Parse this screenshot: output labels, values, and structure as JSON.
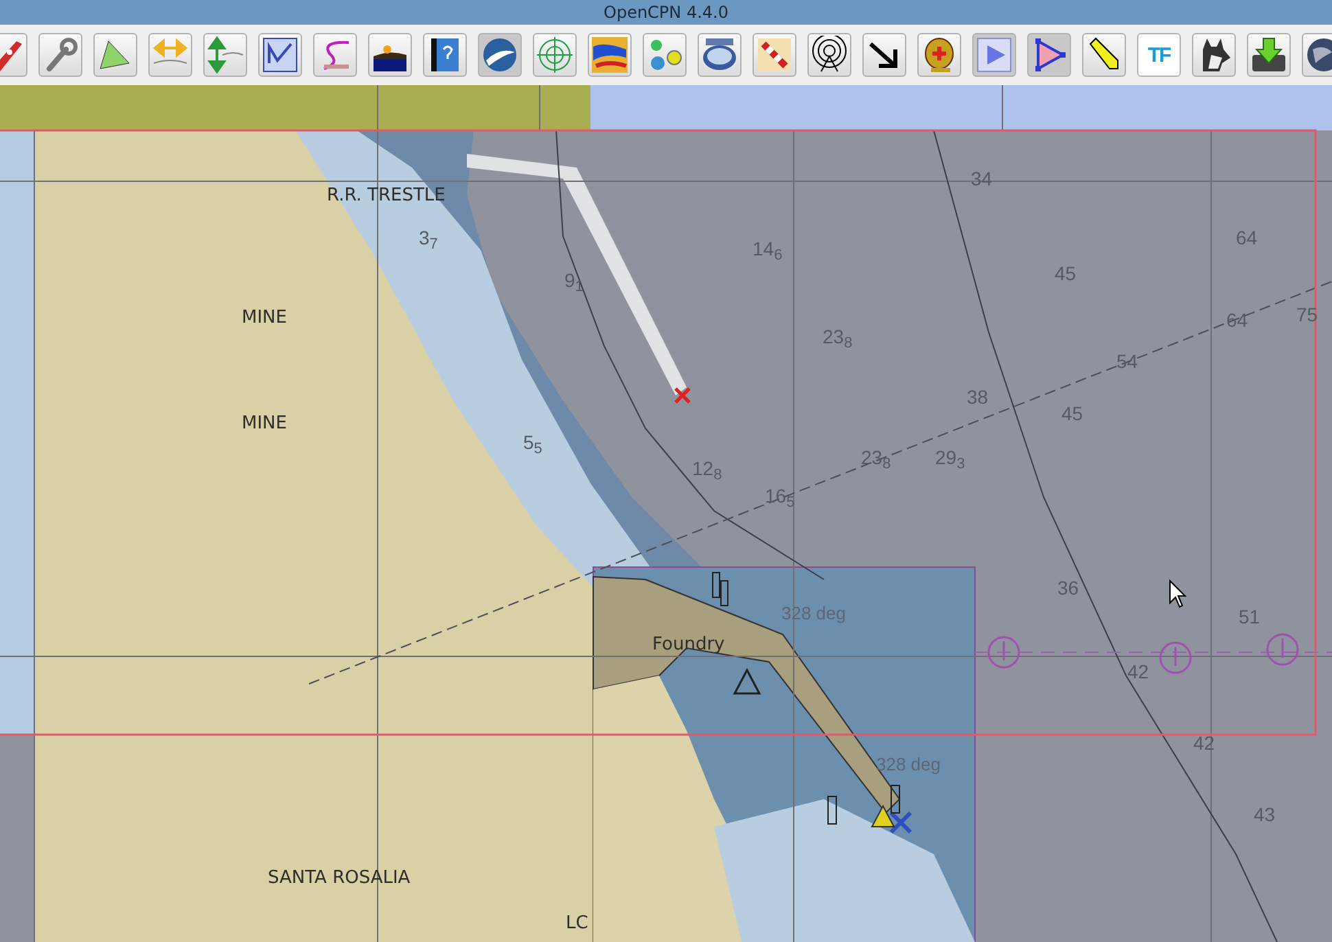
{
  "window": {
    "title": "OpenCPN 4.4.0"
  },
  "toolbar": {
    "text_tool": "TF"
  },
  "chart": {
    "labels": [
      {
        "kind": "place",
        "text": "R.R. TRESTLE"
      },
      {
        "kind": "place",
        "text": "MINE"
      },
      {
        "kind": "place",
        "text": "MINE"
      },
      {
        "kind": "place",
        "text": "Foundry"
      },
      {
        "kind": "place",
        "text": "SANTA ROSALIA"
      },
      {
        "kind": "place",
        "text": "LC"
      },
      {
        "kind": "bearing",
        "text": "328 deg"
      },
      {
        "kind": "bearing",
        "text": "328 deg"
      },
      {
        "kind": "sounding",
        "text": "3$_{7}$"
      },
      {
        "kind": "sounding",
        "text": "9$_{1}$"
      },
      {
        "kind": "sounding",
        "text": "5$_{5}$"
      },
      {
        "kind": "sounding",
        "text": "14$_{6}$"
      },
      {
        "kind": "sounding",
        "text": "23$_{8}$"
      },
      {
        "kind": "sounding",
        "text": "23$_{8}$"
      },
      {
        "kind": "sounding",
        "text": "29$_{3}$"
      },
      {
        "kind": "sounding",
        "text": "12$_{8}$"
      },
      {
        "kind": "sounding",
        "text": "16$_{5}$"
      },
      {
        "kind": "sounding",
        "text": "34"
      },
      {
        "kind": "sounding",
        "text": "45"
      },
      {
        "kind": "sounding",
        "text": "64"
      },
      {
        "kind": "sounding",
        "text": "64"
      },
      {
        "kind": "sounding",
        "text": "75"
      },
      {
        "kind": "sounding",
        "text": "54"
      },
      {
        "kind": "sounding",
        "text": "38"
      },
      {
        "kind": "sounding",
        "text": "45"
      },
      {
        "kind": "sounding",
        "text": "36"
      },
      {
        "kind": "sounding",
        "text": "51"
      },
      {
        "kind": "sounding",
        "text": "42"
      },
      {
        "kind": "sounding",
        "text": "42"
      },
      {
        "kind": "sounding",
        "text": "43"
      }
    ]
  }
}
